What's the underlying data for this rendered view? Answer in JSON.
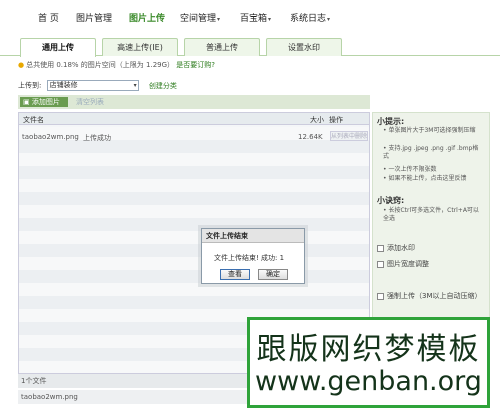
{
  "nav": {
    "items": [
      {
        "label": "首 页"
      },
      {
        "label": "图片管理"
      },
      {
        "label": "图片上传"
      },
      {
        "label": "空间管理"
      },
      {
        "label": "百宝箱"
      },
      {
        "label": "系统日志"
      }
    ],
    "active": "图片上传"
  },
  "tabs": [
    {
      "label": "通用上传"
    },
    {
      "label": "高速上传(IE)"
    },
    {
      "label": "普通上传"
    },
    {
      "label": "设置水印"
    }
  ],
  "info": {
    "text": "总共使用 0.18% 的图片空间（上限为 1.29G）",
    "link": "是否要订购?"
  },
  "upload_to": {
    "label": "上传到:",
    "selected": "店铺装修",
    "create_link": "创建分类"
  },
  "toolbar": {
    "add_label": "添加图片",
    "clear_label": "清空列表"
  },
  "table": {
    "headers": {
      "filename": "文件名",
      "size": "大小",
      "action": "操作"
    },
    "rows": [
      {
        "filename": "taobao2wm.png",
        "status": "上传成功",
        "size": "12.64K",
        "action": "从列表中删除"
      }
    ]
  },
  "status_bar": {
    "count": "1个文件",
    "current_file": "taobao2wm.png"
  },
  "tips": {
    "title": "小提示:",
    "items": [
      "单张图片大于3M可选择强制压缩",
      "支持.jpg .jpeg .png .gif .bmp格式",
      "一次上传不限张数",
      "如果不能上传，点击这里反馈"
    ],
    "feedback_link": "这里",
    "trick_title": "小诀窍:",
    "trick_items": [
      "长按Ctrl可多选文件，Ctrl+A可以全选"
    ],
    "checkboxes": [
      "添加水印",
      "图片宽度调整",
      "强制上传（3M以上自动压缩）"
    ]
  },
  "dialog": {
    "title": "文件上传结束",
    "message": "文件上传结束! 成功: 1",
    "view_label": "查看",
    "ok_label": "确定"
  },
  "watermark": {
    "line1": "跟版网织梦模板",
    "line2": "www.genban.org"
  },
  "colors": {
    "accent_green": "#3a8a2a",
    "tab_border": "#b7d4a8",
    "watermark_border": "#2fa33a"
  }
}
